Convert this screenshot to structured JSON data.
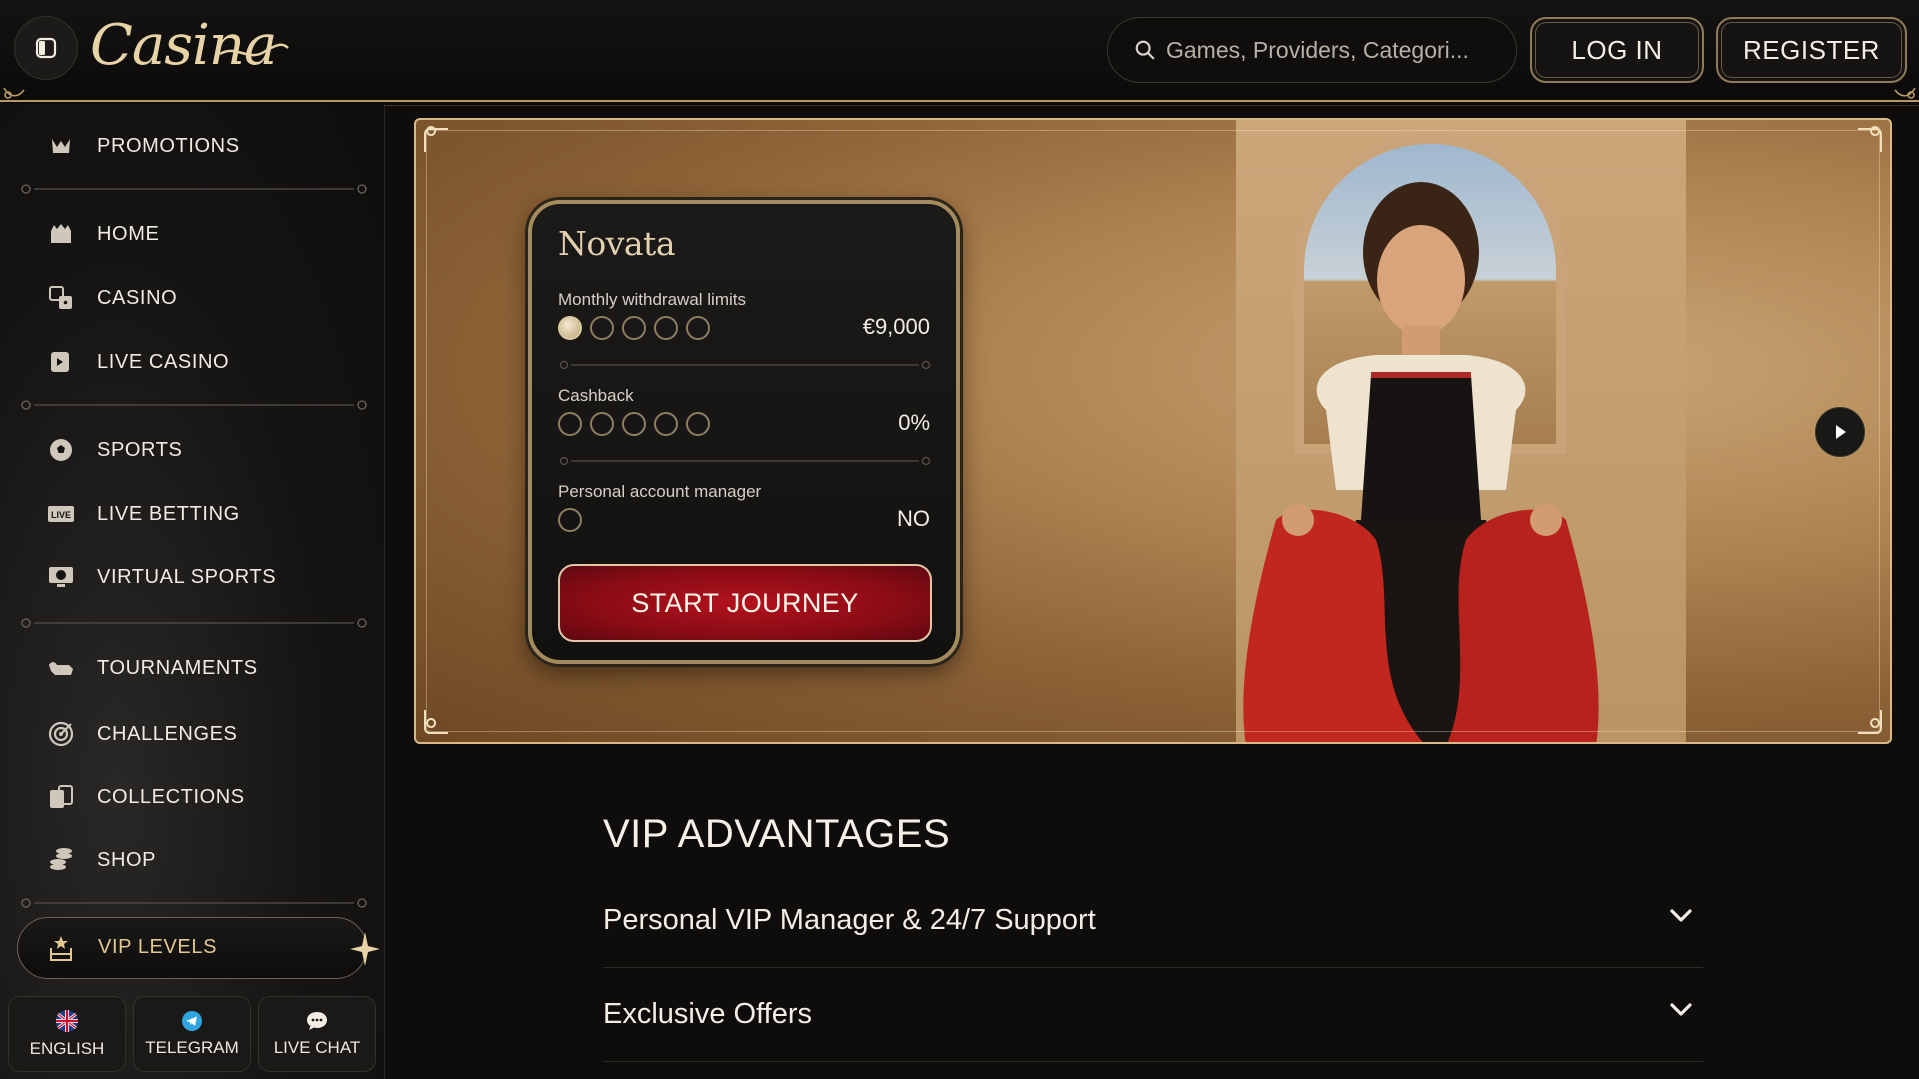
{
  "header": {
    "logo_text": "Casina",
    "search_placeholder": "Games, Providers, Categori...",
    "login_label": "LOG IN",
    "register_label": "REGISTER"
  },
  "sidebar": {
    "items": [
      {
        "label": "PROMOTIONS",
        "icon": "gift-icon"
      },
      {
        "label": "HOME",
        "icon": "home-icon"
      },
      {
        "label": "CASINO",
        "icon": "dice-icon"
      },
      {
        "label": "LIVE CASINO",
        "icon": "live-casino-icon"
      },
      {
        "label": "SPORTS",
        "icon": "soccer-ball-icon"
      },
      {
        "label": "LIVE BETTING",
        "icon": "live-badge-icon"
      },
      {
        "label": "VIRTUAL SPORTS",
        "icon": "virtual-sports-icon"
      },
      {
        "label": "TOURNAMENTS",
        "icon": "bull-icon"
      },
      {
        "label": "CHALLENGES",
        "icon": "target-icon"
      },
      {
        "label": "COLLECTIONS",
        "icon": "cards-icon"
      },
      {
        "label": "SHOP",
        "icon": "coins-icon"
      }
    ],
    "vip_label": "VIP LEVELS",
    "bottom": {
      "language": "ENGLISH",
      "telegram": "TELEGRAM",
      "live_chat": "LIVE CHAT"
    }
  },
  "hero": {
    "card": {
      "title": "Novata",
      "withdrawal_label": "Monthly withdrawal limits",
      "withdrawal_value": "€9,000",
      "withdrawal_level": 1,
      "cashback_label": "Cashback",
      "cashback_value": "0%",
      "cashback_level": 0,
      "manager_label": "Personal account manager",
      "manager_value": "NO",
      "cta_label": "START JOURNEY"
    }
  },
  "vip_advantages": {
    "title": "VIP ADVANTAGES",
    "items": [
      "Personal VIP Manager & 24/7 Support",
      "Exclusive Offers"
    ]
  },
  "colors": {
    "gold_accent": "#b79a63",
    "cta_red": "#a5101b",
    "background": "#0e0d0c"
  }
}
